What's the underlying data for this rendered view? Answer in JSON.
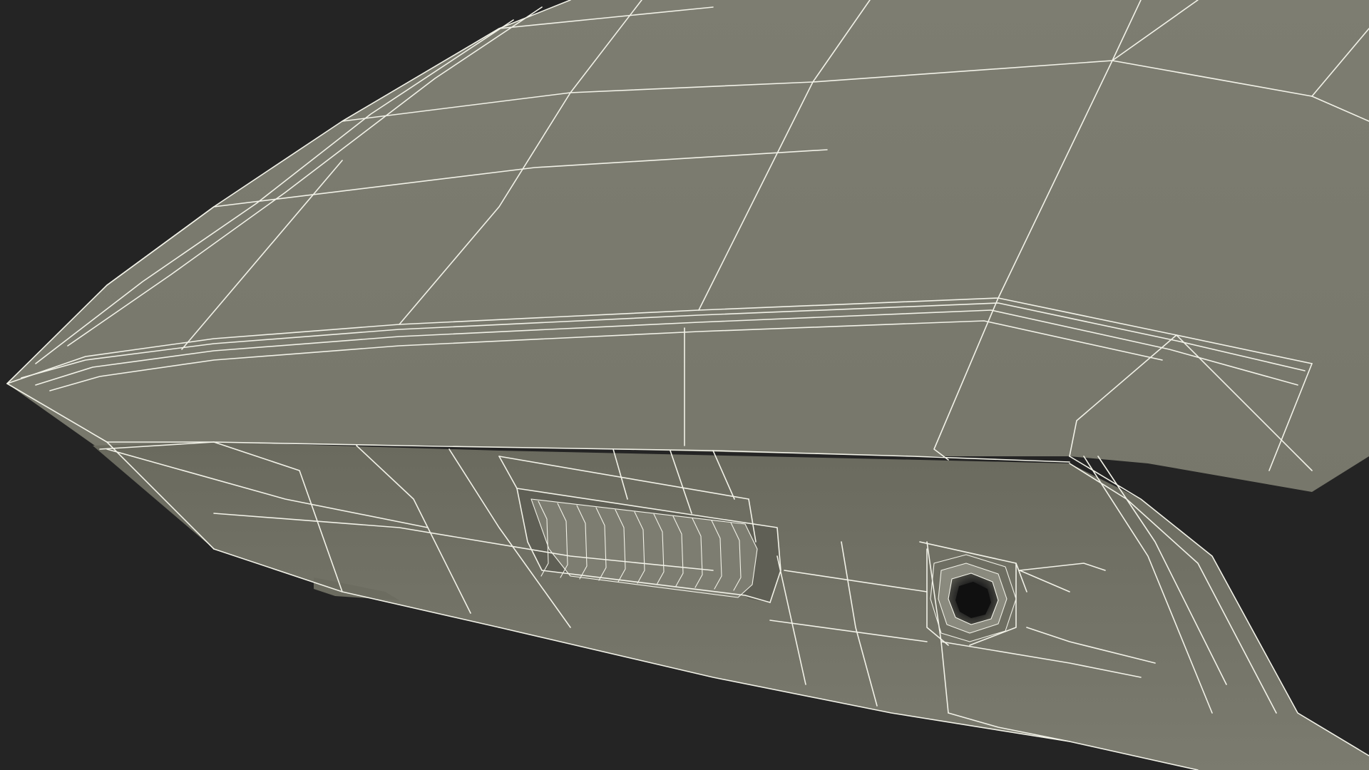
{
  "scene": {
    "background_color": "#242424",
    "surface_color": "#7a7a6e",
    "surface_shadow_color": "#6e6e62",
    "wire_color": "#f2f2e8",
    "hole_color": "#141414",
    "render_style": "wireframe-over-shaded"
  }
}
